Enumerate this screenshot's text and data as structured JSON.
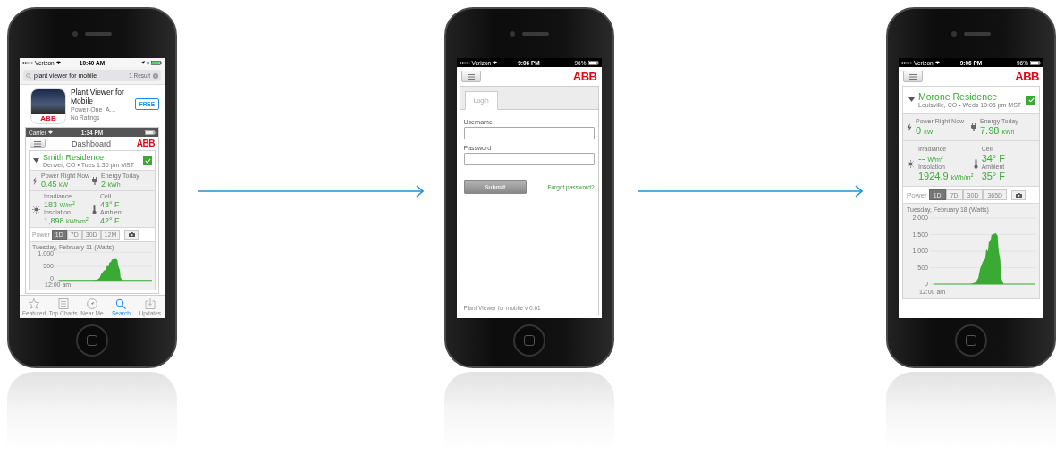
{
  "phones": [
    {
      "kind": "app_store",
      "status_bar": {
        "carrier": "Verizon",
        "time": "10:40 AM"
      },
      "search": {
        "value": "plant viewer for mobile",
        "result_count": "1 Result"
      },
      "app": {
        "logo": "ABB",
        "title": "Plant Viewer for Mobile",
        "developer": "Power-One  A…",
        "rating": "No Ratings",
        "price_button": "FREE"
      },
      "screenshot": {
        "status_bar": {
          "carrier": "Carrier",
          "time": "1:34 PM"
        },
        "title": "Dashboard",
        "logo": "ABB",
        "site": {
          "name": "Smith Residence",
          "subtitle": "Denver, CO • Tues 1:30 pm MST",
          "checked": true
        },
        "metric_rows": [
          [
            {
              "kind": "bolt",
              "readings": [
                {
                  "label": "Power Right Now",
                  "value": "0.45",
                  "unit": "kW"
                }
              ]
            },
            {
              "kind": "plug",
              "readings": [
                {
                  "label": "Energy Today",
                  "value": "2",
                  "unit": "kWh"
                }
              ]
            }
          ],
          [
            {
              "kind": "sun",
              "readings": [
                {
                  "label": "Irradiance",
                  "value": "183",
                  "unit": "W/m$^{2}$"
                },
                {
                  "label": "Insolation",
                  "value": "1,898",
                  "unit": "kWh/m$^{2}$"
                }
              ]
            },
            {
              "kind": "thermometer",
              "readings": [
                {
                  "label": "Cell",
                  "value": "43° F"
                },
                {
                  "label": "Ambient",
                  "value": "42° F"
                }
              ]
            }
          ]
        ],
        "range": {
          "label": "Power",
          "options": [
            {
              "label": "1D",
              "selected": true
            },
            {
              "label": "7D",
              "selected": false
            },
            {
              "label": "30D",
              "selected": false
            },
            {
              "label": "12M",
              "selected": false
            }
          ]
        },
        "chart": {
          "caption": "Tuesday, February 11 (Watts)",
          "y_ticks": [
            "1,000",
            "500",
            "0"
          ],
          "x_label": "12:00 am"
        }
      },
      "tab_bar": [
        {
          "kind": "star",
          "label": "Featured",
          "selected": false
        },
        {
          "kind": "list",
          "label": "Top Charts",
          "selected": false
        },
        {
          "kind": "compass",
          "label": "Near Me",
          "selected": false
        },
        {
          "kind": "search",
          "label": "Search",
          "selected": true
        },
        {
          "kind": "updates",
          "label": "Updates",
          "selected": false
        }
      ]
    },
    {
      "kind": "login",
      "status_bar": {
        "carrier": "Verizon",
        "time": "9:06 PM",
        "battery": "96%"
      },
      "logo": "ABB",
      "tabs": [
        {
          "label": "Login",
          "selected": true
        }
      ],
      "fields": [
        {
          "label": "Username"
        },
        {
          "label": "Password"
        }
      ],
      "submit_button": "Submit",
      "forgot_link": "Forgot password?",
      "footer": "Plant Viewer for mobile v 0.61"
    },
    {
      "kind": "dashboard",
      "status_bar": {
        "carrier": "Verizon",
        "time": "9:06 PM",
        "battery": "96%"
      },
      "dashboard": {
        "logo": "ABB",
        "site": {
          "name": "Morone Residence",
          "subtitle": "Louisville, CO • Weds 10:06 pm MST",
          "checked": true
        },
        "metric_rows": [
          [
            {
              "kind": "bolt",
              "readings": [
                {
                  "label": "Power Right Now",
                  "value": "0",
                  "unit": "kW"
                }
              ]
            },
            {
              "kind": "plug",
              "readings": [
                {
                  "label": "Energy Today",
                  "value": "7.98",
                  "unit": "kWh"
                }
              ]
            }
          ],
          [
            {
              "kind": "sun",
              "readings": [
                {
                  "label": "Irradiance",
                  "value": "--",
                  "unit": "W/m$^{2}$"
                },
                {
                  "label": "Insolation",
                  "value": "1924.9",
                  "unit": "kWh/m$^{2}$"
                }
              ]
            },
            {
              "kind": "thermometer",
              "readings": [
                {
                  "label": "Cell",
                  "value": "34° F"
                },
                {
                  "label": "Ambient",
                  "value": "35° F"
                }
              ]
            }
          ]
        ],
        "range": {
          "label": "Power",
          "options": [
            {
              "label": "1D",
              "selected": true
            },
            {
              "label": "7D",
              "selected": false
            },
            {
              "label": "30D",
              "selected": false
            },
            {
              "label": "365D",
              "selected": false
            }
          ]
        },
        "chart": {
          "caption": "Tuesday, February 18 (Watts)",
          "y_ticks": [
            "2,000",
            "1,500",
            "1,000",
            "500",
            "0"
          ],
          "x_label": "12:00 am"
        }
      }
    }
  ]
}
